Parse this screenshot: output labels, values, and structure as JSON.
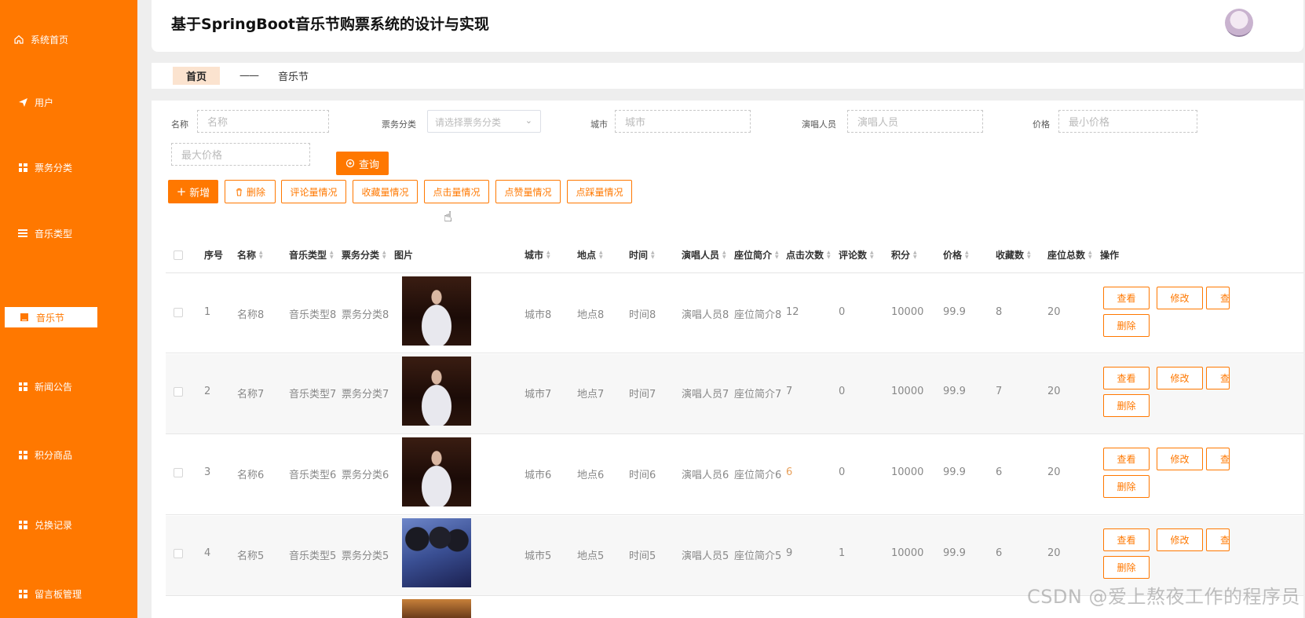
{
  "sidebar": {
    "items": [
      {
        "label": "系统首页",
        "icon": "home-icon"
      },
      {
        "label": "用户",
        "icon": "send-icon"
      },
      {
        "label": "票务分类",
        "icon": "grid-icon"
      },
      {
        "label": "音乐类型",
        "icon": "list-icon"
      },
      {
        "label": "音乐节",
        "icon": "grid-icon",
        "active": true
      },
      {
        "label": "新闻公告",
        "icon": "grid-icon"
      },
      {
        "label": "积分商品",
        "icon": "grid-icon"
      },
      {
        "label": "兑换记录",
        "icon": "grid-icon"
      },
      {
        "label": "留言板管理",
        "icon": "grid-icon"
      }
    ]
  },
  "header": {
    "title": "基于SpringBoot音乐节购票系统的设计与实现"
  },
  "breadcrumb": {
    "home": "首页",
    "separator": "——",
    "current": "音乐节"
  },
  "search": {
    "name_label": "名称",
    "name_placeholder": "名称",
    "category_label": "票务分类",
    "category_placeholder": "请选择票务分类",
    "city_label": "城市",
    "city_placeholder": "城市",
    "performer_label": "演唱人员",
    "performer_placeholder": "演唱人员",
    "price_label": "价格",
    "min_price_placeholder": "最小价格",
    "max_price_placeholder": "最大价格",
    "query_button": "查询"
  },
  "toolbar": {
    "add": "新增",
    "delete": "删除",
    "comment_stats": "评论量情况",
    "favorite_stats": "收藏量情况",
    "click_stats": "点击量情况",
    "like_stats": "点赞量情况",
    "dislike_stats": "点踩量情况"
  },
  "table": {
    "columns": {
      "index": "序号",
      "name": "名称",
      "music_type": "音乐类型",
      "ticket_category": "票务分类",
      "image": "图片",
      "city": "城市",
      "location": "地点",
      "time": "时间",
      "performer": "演唱人员",
      "seat_intro": "座位简介",
      "clicks": "点击次数",
      "comments": "评论数",
      "points": "积分",
      "price": "价格",
      "favorites": "收藏数",
      "total_seats": "座位总数",
      "actions": "操作"
    },
    "rows": [
      {
        "index": "1",
        "name": "名称8",
        "music_type": "音乐类型8",
        "ticket_category": "票务分类8",
        "city": "城市8",
        "location": "地点8",
        "time": "时间8",
        "performer": "演唱人员8",
        "seat_intro": "座位简介8",
        "clicks": "12",
        "comments": "0",
        "points": "10000",
        "price": "99.9",
        "favorites": "8",
        "total_seats": "20",
        "image": "singer"
      },
      {
        "index": "2",
        "name": "名称7",
        "music_type": "音乐类型7",
        "ticket_category": "票务分类7",
        "city": "城市7",
        "location": "地点7",
        "time": "时间7",
        "performer": "演唱人员7",
        "seat_intro": "座位简介7",
        "clicks": "7",
        "comments": "0",
        "points": "10000",
        "price": "99.9",
        "favorites": "7",
        "total_seats": "20",
        "image": "singer"
      },
      {
        "index": "3",
        "name": "名称6",
        "music_type": "音乐类型6",
        "ticket_category": "票务分类6",
        "city": "城市6",
        "location": "地点6",
        "time": "时间6",
        "performer": "演唱人员6",
        "seat_intro": "座位简介6",
        "clicks": "6",
        "comments": "0",
        "points": "10000",
        "price": "99.9",
        "favorites": "6",
        "total_seats": "20",
        "image": "singer"
      },
      {
        "index": "4",
        "name": "名称5",
        "music_type": "音乐类型5",
        "ticket_category": "票务分类5",
        "city": "城市5",
        "location": "地点5",
        "time": "时间5",
        "performer": "演唱人员5",
        "seat_intro": "座位简介5",
        "clicks": "9",
        "comments": "1",
        "points": "10000",
        "price": "99.9",
        "favorites": "6",
        "total_seats": "20",
        "image": "band"
      }
    ],
    "actions": {
      "view": "查看",
      "edit": "修改",
      "more": "查",
      "delete": "删除"
    }
  },
  "watermark": "CSDN @爱上熬夜工作的程序员",
  "colors": {
    "accent": "#ff7800",
    "breadcrumb_active": "#fbe3cf"
  }
}
